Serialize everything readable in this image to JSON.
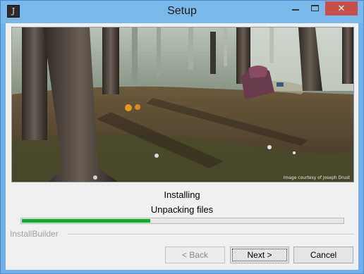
{
  "window": {
    "title": "Setup",
    "icon": "installer-app-icon",
    "controls": {
      "minimize": "minimize-icon",
      "maximize": "maximize-icon",
      "close": "close-icon"
    }
  },
  "banner": {
    "image": "forest-scene",
    "credit": "Image courtesy of Joseph Drust"
  },
  "status": {
    "title": "Installing",
    "detail": "Unpacking files"
  },
  "progress": {
    "fraction": 0.4,
    "color": "#06b025"
  },
  "brand": "InstallBuilder",
  "buttons": {
    "back": "< Back",
    "next": "Next >",
    "cancel": "Cancel"
  },
  "colors": {
    "titlebar": "#79b8ea",
    "close": "#c7504a"
  }
}
